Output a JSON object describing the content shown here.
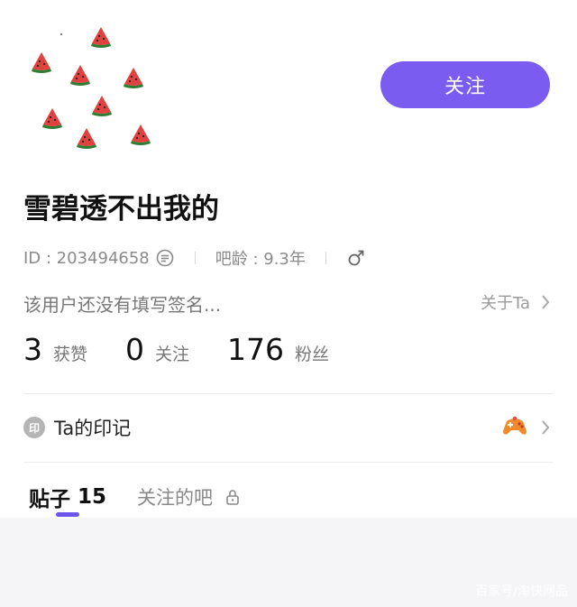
{
  "header": {
    "follow_label": "关注"
  },
  "profile": {
    "username": "雪碧透不出我的",
    "id_text": "ID : 203494658",
    "bar_age_text": "吧龄 : 9.3年",
    "gender_icon": "male-gender-icon",
    "signature": "该用户还没有填写签名...",
    "about_label": "关于Ta"
  },
  "stats": [
    {
      "value": "3",
      "label": "获赞"
    },
    {
      "value": "0",
      "label": "关注"
    },
    {
      "value": "176",
      "label": "粉丝"
    }
  ],
  "marks": {
    "badge": "印",
    "label": "Ta的印记",
    "icon": "gamepad-icon"
  },
  "tabs": {
    "posts_label": "贴子",
    "posts_count": "15",
    "followed_bars_label": "关注的吧"
  },
  "watermark": "百家号/淘快网品",
  "colors": {
    "accent": "#7b5cf0",
    "tab_indicator": "#6c55e8",
    "watermelon_red": "#e0433f",
    "watermelon_green": "#2e7d32"
  }
}
